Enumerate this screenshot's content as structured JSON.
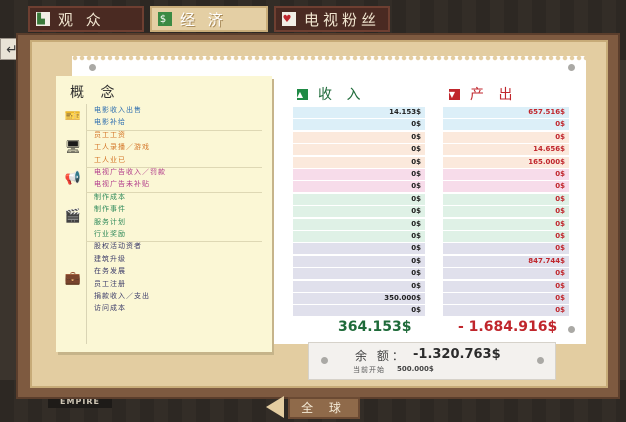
{
  "tabs": [
    {
      "label": "观 众",
      "icon": "bar-chart-icon"
    },
    {
      "label": "经 济",
      "icon": "money-icon",
      "active": true
    },
    {
      "label": "电视粉丝",
      "icon": "heart-icon"
    }
  ],
  "concept_title": "概 念",
  "income_header": "收 入",
  "output_header": "产 出",
  "groups": [
    {
      "icon": "ticket-icon",
      "glyph": "🎫",
      "rows": [
        {
          "label": "电影收入出售",
          "color": "#2f6fb0",
          "income": "14.153$",
          "output": "657.516$",
          "bg": "#dceff8"
        },
        {
          "label": "电影补给",
          "color": "#2f6fb0",
          "income": "0$",
          "output": "0$",
          "bg": "#dceff8"
        }
      ]
    },
    {
      "icon": "monitor-icon",
      "glyph": "🖥",
      "rows": [
        {
          "label": "员工工资",
          "color": "#d4772a",
          "income": "0$",
          "output": "0$",
          "bg": "#fbe9dc"
        },
        {
          "label": "工人录播／游戏",
          "color": "#d4772a",
          "income": "0$",
          "output": "14.656$",
          "bg": "#fbe9dc"
        },
        {
          "label": "工人业已",
          "color": "#d4772a",
          "income": "0$",
          "output": "165.000$",
          "bg": "#fbe9dc"
        }
      ]
    },
    {
      "icon": "megaphone-icon",
      "glyph": "📢",
      "rows": [
        {
          "label": "电视广告收入／罚款",
          "color": "#b13a8a",
          "income": "0$",
          "output": "0$",
          "bg": "#f7dcea"
        },
        {
          "label": "电视广告未补贴",
          "color": "#b13a8a",
          "income": "0$",
          "output": "0$",
          "bg": "#f7dcea"
        }
      ]
    },
    {
      "icon": "clapperboard-icon",
      "glyph": "🎬",
      "rows": [
        {
          "label": "制作成本",
          "color": "#2f8a5a",
          "income": "0$",
          "output": "0$",
          "bg": "#dff1e6"
        },
        {
          "label": "制作事件",
          "color": "#2f8a5a",
          "income": "0$",
          "output": "0$",
          "bg": "#dff1e6"
        },
        {
          "label": "服务计划",
          "color": "#2f8a5a",
          "income": "0$",
          "output": "0$",
          "bg": "#dff1e6"
        },
        {
          "label": "行业奖励",
          "color": "#2f8a5a",
          "income": "0$",
          "output": "0$",
          "bg": "#dff1e6"
        }
      ]
    },
    {
      "icon": "briefcase-icon",
      "glyph": "💼",
      "rows": [
        {
          "label": "股权活动资者",
          "color": "#3d3d6a",
          "income": "0$",
          "output": "0$",
          "bg": "#e0e0ec"
        },
        {
          "label": "建筑升级",
          "color": "#3d3d6a",
          "income": "0$",
          "output": "847.744$",
          "bg": "#e0e0ec"
        },
        {
          "label": "在务发展",
          "color": "#3d3d6a",
          "income": "0$",
          "output": "0$",
          "bg": "#e0e0ec"
        },
        {
          "label": "员工注册",
          "color": "#3d3d6a",
          "income": "0$",
          "output": "0$",
          "bg": "#e0e0ec"
        },
        {
          "label": "捐款收入／支出",
          "color": "#3d3d6a",
          "income": "350.000$",
          "output": "0$",
          "bg": "#e0e0ec"
        },
        {
          "label": "访问成本",
          "color": "#3d3d6a",
          "income": "0$",
          "output": "0$",
          "bg": "#e0e0ec"
        }
      ]
    }
  ],
  "total_income": "364.153$",
  "total_output": "- 1.684.916$",
  "balance_label": "余 额：",
  "balance_value": "-1.320.763$",
  "balance_start_label": "当前开始",
  "balance_start_value": "500.000$",
  "bottom_button": "全 球",
  "background_text": "EMPIRE",
  "colors": {
    "income": "#1f6b3a",
    "output": "#c0262c",
    "frame": "#7e5a40",
    "board": "#e3cda1"
  }
}
